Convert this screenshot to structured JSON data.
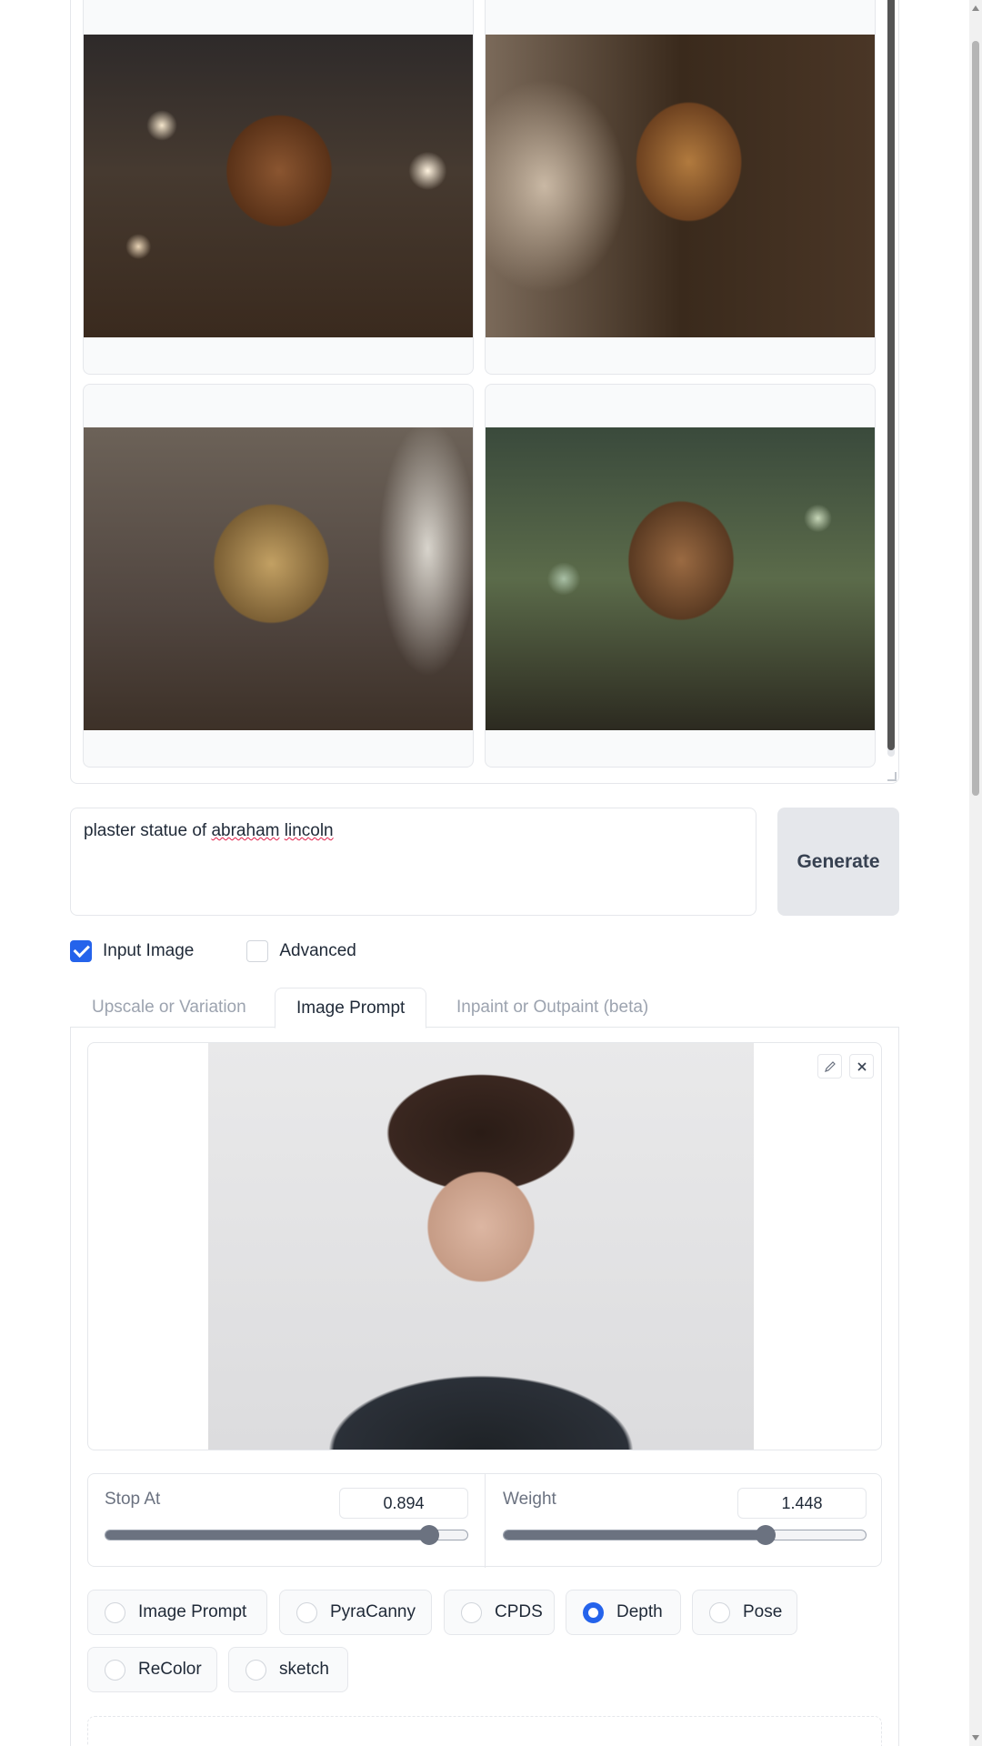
{
  "gallery": {
    "images": [
      {
        "name": "statue-portrait-1"
      },
      {
        "name": "statue-portrait-2"
      },
      {
        "name": "statue-portrait-3"
      },
      {
        "name": "statue-portrait-4"
      }
    ]
  },
  "prompt": {
    "value_parts": [
      "plaster statue of ",
      "abraham",
      " ",
      "lincoln"
    ]
  },
  "generate_label": "Generate",
  "checkboxes": {
    "input_image": {
      "label": "Input Image",
      "checked": true
    },
    "advanced": {
      "label": "Advanced",
      "checked": false
    }
  },
  "tabs": [
    {
      "label": "Upscale or Variation",
      "active": false
    },
    {
      "label": "Image Prompt",
      "active": true
    },
    {
      "label": "Inpaint or Outpaint (beta)",
      "active": false
    }
  ],
  "image_prompt": {
    "edit_icon": "pencil-icon",
    "close_icon": "close-icon",
    "stop_at": {
      "label": "Stop At",
      "value": "0.894",
      "fraction": 0.894
    },
    "weight": {
      "label": "Weight",
      "value": "1.448",
      "fraction": 0.724
    }
  },
  "cn_types": {
    "selected": "Depth",
    "options": [
      "Image Prompt",
      "PyraCanny",
      "CPDS",
      "Depth",
      "Pose",
      "ReColor",
      "sketch"
    ]
  },
  "colors": {
    "accent": "#2563eb"
  }
}
